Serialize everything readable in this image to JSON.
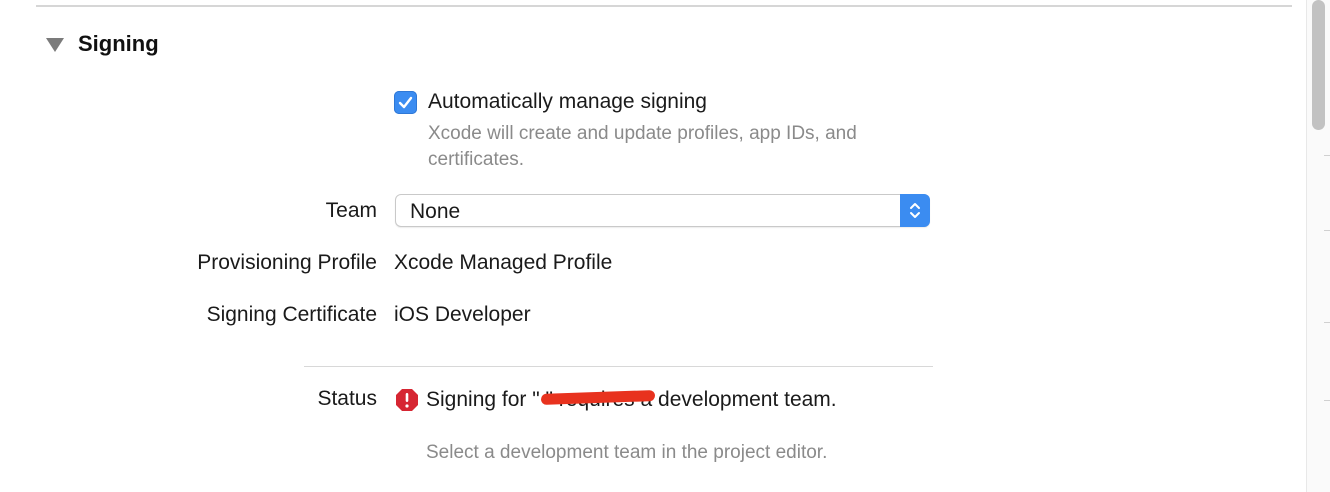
{
  "section": {
    "title": "Signing"
  },
  "auto": {
    "label": "Automatically manage signing",
    "description": "Xcode will create and update profiles, app IDs, and certificates.",
    "checked": true
  },
  "team": {
    "label": "Team",
    "value": "None"
  },
  "provisioning": {
    "label": "Provisioning Profile",
    "value": "Xcode Managed Profile"
  },
  "certificate": {
    "label": "Signing Certificate",
    "value": "iOS Developer"
  },
  "status": {
    "label": "Status",
    "message": "Signing for \"               \" requires a development team.",
    "detail": "Select a development team in the project editor."
  },
  "colors": {
    "accent": "#3b8cf1",
    "error": "#d62632",
    "redaction": "#e8321e"
  },
  "icons": {
    "disclosure": "disclosure-triangle-down-icon",
    "check": "checkmark-icon",
    "error": "error-octagon-icon",
    "stepper": "up-down-chevron-icon"
  }
}
